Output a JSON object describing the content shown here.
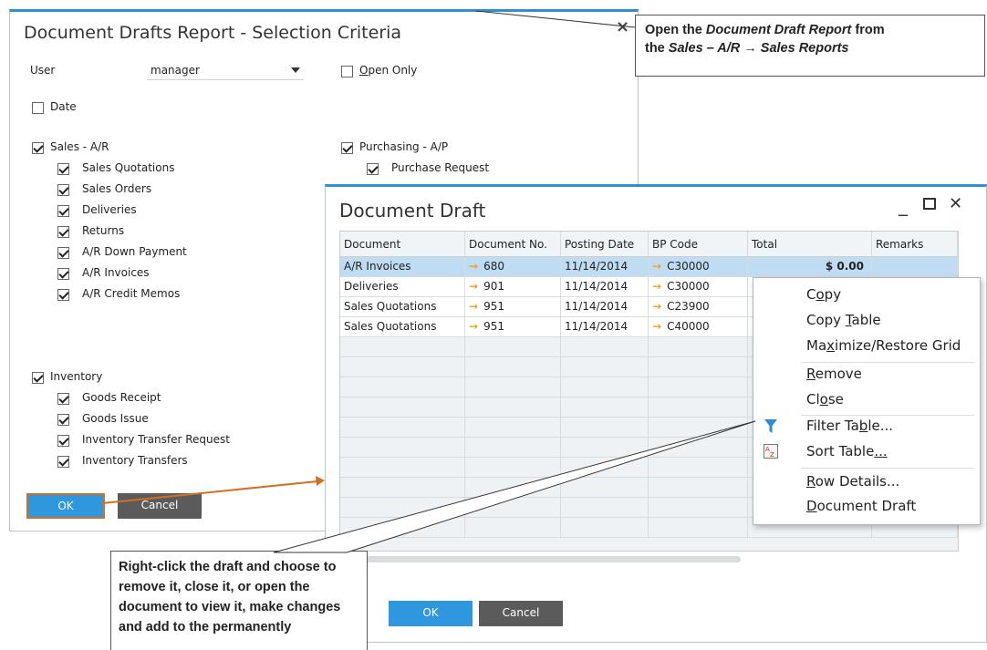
{
  "selection": {
    "title": "Document Drafts Report - Selection Criteria",
    "user_label": "User",
    "user_value": "manager",
    "open_only_label": "Open Only",
    "date_label": "Date",
    "sales_group": "Sales - A/R",
    "sales_items": [
      "Sales Quotations",
      "Sales Orders",
      "Deliveries",
      "Returns",
      "A/R Down Payment",
      "A/R Invoices",
      "A/R Credit Memos"
    ],
    "purchasing_group": "Purchasing - A/P",
    "purchasing_items": [
      "Purchase Request"
    ],
    "inventory_group": "Inventory",
    "inventory_items": [
      "Goods Receipt",
      "Goods Issue",
      "Inventory Transfer Request",
      "Inventory Transfers"
    ],
    "ok": "OK",
    "cancel": "Cancel",
    "close_glyph": "×"
  },
  "callout_top": {
    "line1_a": "Open the ",
    "line1_b": "Document Draft Report",
    "line1_c": " from",
    "line2_a": "the ",
    "line2_b": "Sales – A/R → Sales Reports"
  },
  "draft": {
    "title": "Document Draft",
    "min_glyph": "_",
    "max_glyph": "☐",
    "close_glyph": "✕",
    "columns": [
      "Document",
      "Document No.",
      "Posting Date",
      "BP Code",
      "Total",
      "Remarks"
    ],
    "rows": [
      {
        "doc": "A/R Invoices",
        "no": "680",
        "date": "11/14/2014",
        "bp": "C30000",
        "total": "$ 0.00"
      },
      {
        "doc": "Deliveries",
        "no": "901",
        "date": "11/14/2014",
        "bp": "C30000",
        "total": ""
      },
      {
        "doc": "Sales Quotations",
        "no": "951",
        "date": "11/14/2014",
        "bp": "C23900",
        "total": ""
      },
      {
        "doc": "Sales Quotations",
        "no": "951",
        "date": "11/14/2014",
        "bp": "C40000",
        "total": ""
      }
    ],
    "ok": "OK",
    "cancel": "Cancel"
  },
  "menu": {
    "items": [
      "Copy",
      "Copy Table",
      "Maximize/Restore Grid",
      "Remove",
      "Close",
      "Filter Table...",
      "Sort Table...",
      "Row Details...",
      "Document Draft"
    ]
  },
  "callout_bottom": {
    "text": "Right-click the draft and choose to remove it, close it, or open the document to view it, make changes and add to the permanently"
  },
  "colors": {
    "accent": "#2f8fd6",
    "ok_button": "#2e97dd",
    "cancel_button": "#5b5b5b",
    "selected_row": "#bfdcf3",
    "arrow_link": "#f0a020",
    "pointer_line": "#d07020"
  }
}
